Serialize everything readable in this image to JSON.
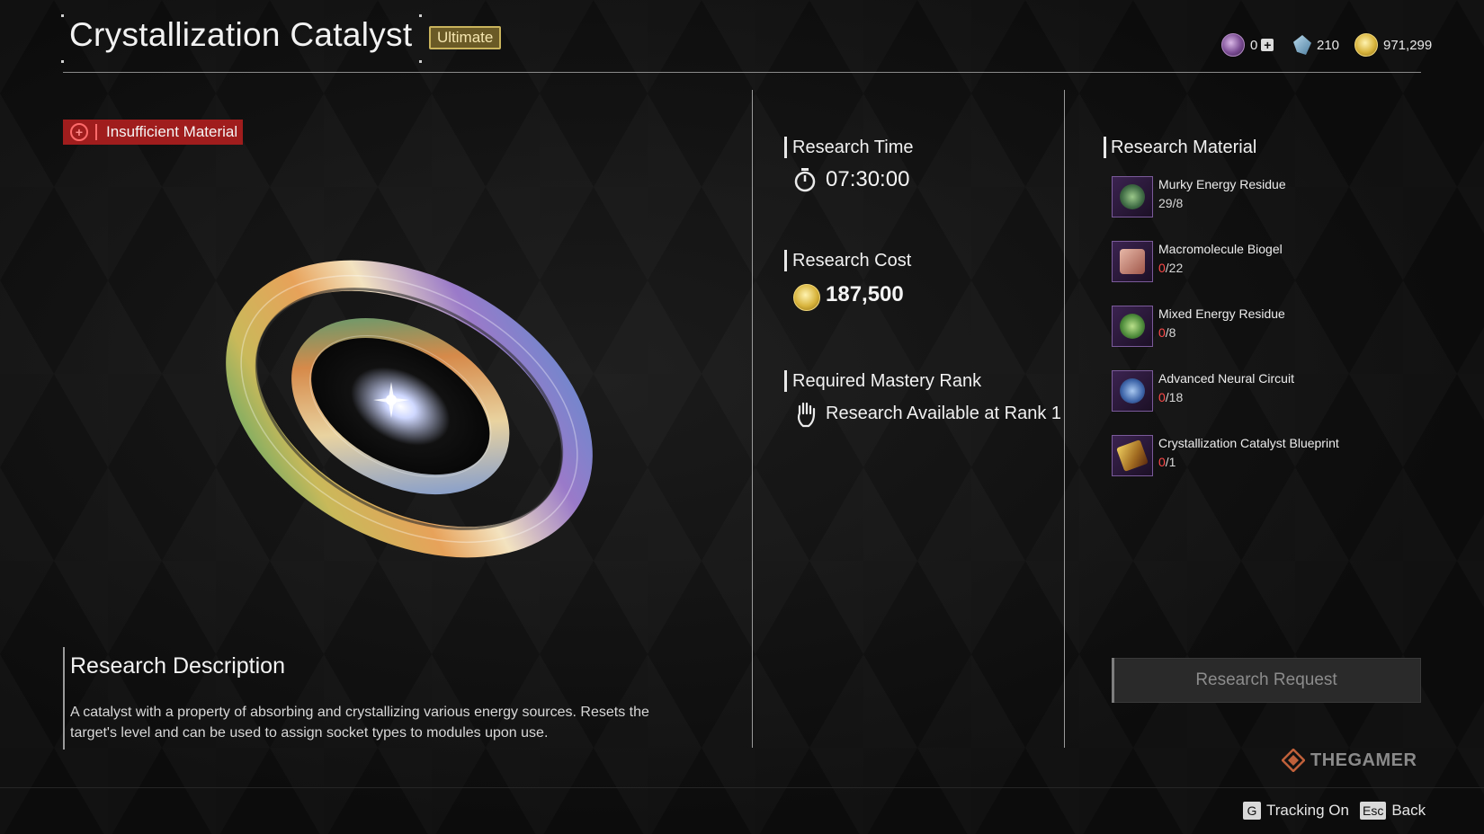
{
  "header": {
    "title": "Crystallization Catalyst",
    "grade": "Ultimate",
    "currencies": [
      {
        "icon": "crystal-currency-icon",
        "value": "0"
      },
      {
        "icon": "shard-currency-icon",
        "value": "210"
      },
      {
        "icon": "gold-coin-icon",
        "value": "971,299"
      }
    ]
  },
  "status": {
    "warning": "Insufficient Material",
    "color": "#a01d1d"
  },
  "research_time": {
    "label": "Research Time",
    "value": "07:30:00",
    "icon": "stopwatch-icon"
  },
  "research_cost": {
    "label": "Research Cost",
    "value": "187,500",
    "icon": "gold-coin-icon"
  },
  "mastery": {
    "label": "Required Mastery Rank",
    "value": "Research Available at Rank 1",
    "icon": "hand-icon"
  },
  "materials": {
    "label": "Research Material",
    "items": [
      {
        "name": "Murky Energy Residue",
        "have": "29",
        "need": "/8",
        "sufficient": true,
        "icon": "murky-energy-residue-icon"
      },
      {
        "name": "Macromolecule Biogel",
        "have": "0",
        "need": "/22",
        "sufficient": false,
        "icon": "biogel-icon"
      },
      {
        "name": "Mixed Energy Residue",
        "have": "0",
        "need": "/8",
        "sufficient": false,
        "icon": "mixed-energy-residue-icon"
      },
      {
        "name": "Advanced Neural Circuit",
        "have": "0",
        "need": "/18",
        "sufficient": false,
        "icon": "neural-circuit-icon"
      },
      {
        "name": "Crystallization Catalyst Blueprint",
        "have": "0",
        "need": "/1",
        "sufficient": false,
        "icon": "blueprint-icon"
      }
    ]
  },
  "description": {
    "title": "Research Description",
    "text": "A catalyst with a property of absorbing and crystallizing various energy sources. Resets the target's level and can be used to assign socket types to modules upon use."
  },
  "request_button": {
    "label": "Research Request"
  },
  "footer": {
    "tracking_key": "G",
    "tracking_label": "Tracking On",
    "back_key": "Esc",
    "back_label": "Back"
  },
  "watermark": "THEGAMER"
}
